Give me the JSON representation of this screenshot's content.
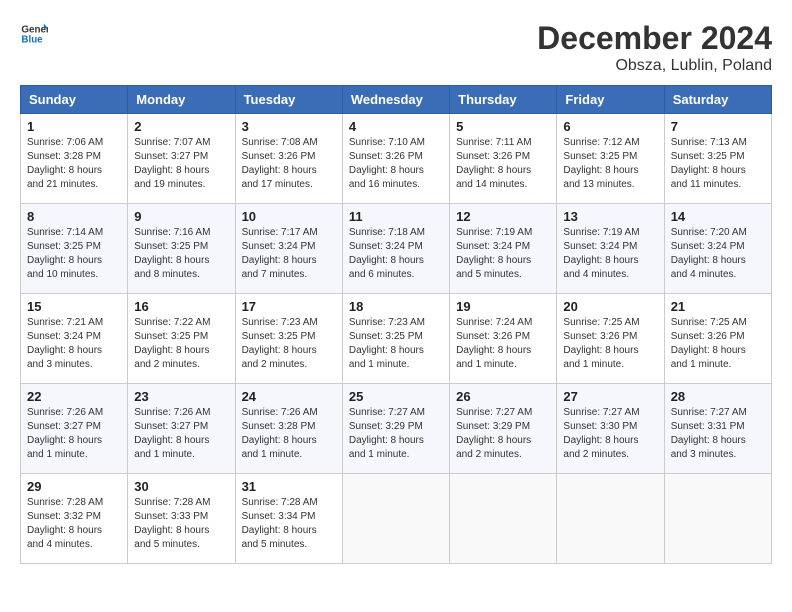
{
  "header": {
    "logo_line1": "General",
    "logo_line2": "Blue",
    "title": "December 2024",
    "subtitle": "Obsza, Lublin, Poland"
  },
  "columns": [
    "Sunday",
    "Monday",
    "Tuesday",
    "Wednesday",
    "Thursday",
    "Friday",
    "Saturday"
  ],
  "weeks": [
    [
      {
        "day": "1",
        "sunrise": "Sunrise: 7:06 AM",
        "sunset": "Sunset: 3:28 PM",
        "daylight": "Daylight: 8 hours and 21 minutes."
      },
      {
        "day": "2",
        "sunrise": "Sunrise: 7:07 AM",
        "sunset": "Sunset: 3:27 PM",
        "daylight": "Daylight: 8 hours and 19 minutes."
      },
      {
        "day": "3",
        "sunrise": "Sunrise: 7:08 AM",
        "sunset": "Sunset: 3:26 PM",
        "daylight": "Daylight: 8 hours and 17 minutes."
      },
      {
        "day": "4",
        "sunrise": "Sunrise: 7:10 AM",
        "sunset": "Sunset: 3:26 PM",
        "daylight": "Daylight: 8 hours and 16 minutes."
      },
      {
        "day": "5",
        "sunrise": "Sunrise: 7:11 AM",
        "sunset": "Sunset: 3:26 PM",
        "daylight": "Daylight: 8 hours and 14 minutes."
      },
      {
        "day": "6",
        "sunrise": "Sunrise: 7:12 AM",
        "sunset": "Sunset: 3:25 PM",
        "daylight": "Daylight: 8 hours and 13 minutes."
      },
      {
        "day": "7",
        "sunrise": "Sunrise: 7:13 AM",
        "sunset": "Sunset: 3:25 PM",
        "daylight": "Daylight: 8 hours and 11 minutes."
      }
    ],
    [
      {
        "day": "8",
        "sunrise": "Sunrise: 7:14 AM",
        "sunset": "Sunset: 3:25 PM",
        "daylight": "Daylight: 8 hours and 10 minutes."
      },
      {
        "day": "9",
        "sunrise": "Sunrise: 7:16 AM",
        "sunset": "Sunset: 3:25 PM",
        "daylight": "Daylight: 8 hours and 8 minutes."
      },
      {
        "day": "10",
        "sunrise": "Sunrise: 7:17 AM",
        "sunset": "Sunset: 3:24 PM",
        "daylight": "Daylight: 8 hours and 7 minutes."
      },
      {
        "day": "11",
        "sunrise": "Sunrise: 7:18 AM",
        "sunset": "Sunset: 3:24 PM",
        "daylight": "Daylight: 8 hours and 6 minutes."
      },
      {
        "day": "12",
        "sunrise": "Sunrise: 7:19 AM",
        "sunset": "Sunset: 3:24 PM",
        "daylight": "Daylight: 8 hours and 5 minutes."
      },
      {
        "day": "13",
        "sunrise": "Sunrise: 7:19 AM",
        "sunset": "Sunset: 3:24 PM",
        "daylight": "Daylight: 8 hours and 4 minutes."
      },
      {
        "day": "14",
        "sunrise": "Sunrise: 7:20 AM",
        "sunset": "Sunset: 3:24 PM",
        "daylight": "Daylight: 8 hours and 4 minutes."
      }
    ],
    [
      {
        "day": "15",
        "sunrise": "Sunrise: 7:21 AM",
        "sunset": "Sunset: 3:24 PM",
        "daylight": "Daylight: 8 hours and 3 minutes."
      },
      {
        "day": "16",
        "sunrise": "Sunrise: 7:22 AM",
        "sunset": "Sunset: 3:25 PM",
        "daylight": "Daylight: 8 hours and 2 minutes."
      },
      {
        "day": "17",
        "sunrise": "Sunrise: 7:23 AM",
        "sunset": "Sunset: 3:25 PM",
        "daylight": "Daylight: 8 hours and 2 minutes."
      },
      {
        "day": "18",
        "sunrise": "Sunrise: 7:23 AM",
        "sunset": "Sunset: 3:25 PM",
        "daylight": "Daylight: 8 hours and 1 minute."
      },
      {
        "day": "19",
        "sunrise": "Sunrise: 7:24 AM",
        "sunset": "Sunset: 3:26 PM",
        "daylight": "Daylight: 8 hours and 1 minute."
      },
      {
        "day": "20",
        "sunrise": "Sunrise: 7:25 AM",
        "sunset": "Sunset: 3:26 PM",
        "daylight": "Daylight: 8 hours and 1 minute."
      },
      {
        "day": "21",
        "sunrise": "Sunrise: 7:25 AM",
        "sunset": "Sunset: 3:26 PM",
        "daylight": "Daylight: 8 hours and 1 minute."
      }
    ],
    [
      {
        "day": "22",
        "sunrise": "Sunrise: 7:26 AM",
        "sunset": "Sunset: 3:27 PM",
        "daylight": "Daylight: 8 hours and 1 minute."
      },
      {
        "day": "23",
        "sunrise": "Sunrise: 7:26 AM",
        "sunset": "Sunset: 3:27 PM",
        "daylight": "Daylight: 8 hours and 1 minute."
      },
      {
        "day": "24",
        "sunrise": "Sunrise: 7:26 AM",
        "sunset": "Sunset: 3:28 PM",
        "daylight": "Daylight: 8 hours and 1 minute."
      },
      {
        "day": "25",
        "sunrise": "Sunrise: 7:27 AM",
        "sunset": "Sunset: 3:29 PM",
        "daylight": "Daylight: 8 hours and 1 minute."
      },
      {
        "day": "26",
        "sunrise": "Sunrise: 7:27 AM",
        "sunset": "Sunset: 3:29 PM",
        "daylight": "Daylight: 8 hours and 2 minutes."
      },
      {
        "day": "27",
        "sunrise": "Sunrise: 7:27 AM",
        "sunset": "Sunset: 3:30 PM",
        "daylight": "Daylight: 8 hours and 2 minutes."
      },
      {
        "day": "28",
        "sunrise": "Sunrise: 7:27 AM",
        "sunset": "Sunset: 3:31 PM",
        "daylight": "Daylight: 8 hours and 3 minutes."
      }
    ],
    [
      {
        "day": "29",
        "sunrise": "Sunrise: 7:28 AM",
        "sunset": "Sunset: 3:32 PM",
        "daylight": "Daylight: 8 hours and 4 minutes."
      },
      {
        "day": "30",
        "sunrise": "Sunrise: 7:28 AM",
        "sunset": "Sunset: 3:33 PM",
        "daylight": "Daylight: 8 hours and 5 minutes."
      },
      {
        "day": "31",
        "sunrise": "Sunrise: 7:28 AM",
        "sunset": "Sunset: 3:34 PM",
        "daylight": "Daylight: 8 hours and 5 minutes."
      },
      null,
      null,
      null,
      null
    ]
  ]
}
